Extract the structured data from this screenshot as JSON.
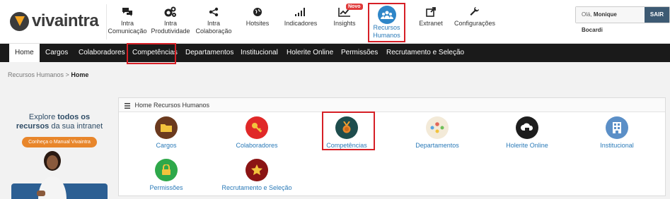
{
  "brand": {
    "name": "vivaintra"
  },
  "modules": [
    {
      "id": "comunicacao",
      "label_1": "Intra",
      "label_2": "Comunicação",
      "icon": "chat-bubbles-icon"
    },
    {
      "id": "produtividade",
      "label_1": "Intra",
      "label_2": "Produtividade",
      "icon": "gears-icon"
    },
    {
      "id": "colaboracao",
      "label_1": "Intra",
      "label_2": "Colaboração",
      "icon": "share-icon"
    },
    {
      "id": "hotsites",
      "label_1": "Hotsites",
      "label_2": "",
      "icon": "globe-icon"
    },
    {
      "id": "indicadores",
      "label_1": "Indicadores",
      "label_2": "",
      "icon": "signal-bars-icon"
    },
    {
      "id": "insights",
      "label_1": "Insights",
      "label_2": "",
      "icon": "trend-chart-icon",
      "badge": "Novo"
    },
    {
      "id": "rh",
      "label_1": "Recursos",
      "label_2": "Humanos",
      "icon": "people-group-icon"
    },
    {
      "id": "extranet",
      "label_1": "Extranet",
      "label_2": "",
      "icon": "external-link-icon"
    },
    {
      "id": "config",
      "label_1": "Configurações",
      "label_2": "",
      "icon": "wrench-icon"
    }
  ],
  "user": {
    "greeting": "Olá,",
    "name": "Monique Bocardi",
    "logout": "SAIR"
  },
  "menu": [
    "Home",
    "Cargos",
    "Colaboradores",
    "Competências",
    "Departamentos",
    "Institucional",
    "Holerite Online",
    "Permissões",
    "Recrutamento e Seleção"
  ],
  "breadcrumb": {
    "parent": "Recursos Humanos",
    "separator": ">",
    "current": "Home"
  },
  "promo": {
    "line1_a": "Explore",
    "line1_b": "todos os",
    "line2_a": "recursos",
    "line2_b": "da sua intranet",
    "cta": "Conheça o Manual Vivaintra"
  },
  "panel": {
    "title": "Home Recursos Humanos",
    "tiles": [
      {
        "label": "Cargos",
        "icon": "folder-icon",
        "color": "#6b3a1e"
      },
      {
        "label": "Colaboradores",
        "icon": "key-icon",
        "color": "#e02828"
      },
      {
        "label": "Competências",
        "icon": "medal-icon",
        "color": "#1e4d4d"
      },
      {
        "label": "Departamentos",
        "icon": "team-icon",
        "color": "#f3ead8"
      },
      {
        "label": "Holerite Online",
        "icon": "cloud-icon",
        "color": "#1d1d1d"
      },
      {
        "label": "Institucional",
        "icon": "building-icon",
        "color": "#5b8fc7"
      },
      {
        "label": "Permissões",
        "icon": "lock-icon",
        "color": "#2ea84a"
      },
      {
        "label": "Recrutamento e Seleção",
        "icon": "star-icon",
        "color": "#8b1414"
      }
    ]
  },
  "colors": {
    "accent": "#2a7ab8",
    "highlight": "#d61f26",
    "menubar": "#1a1a1a"
  }
}
